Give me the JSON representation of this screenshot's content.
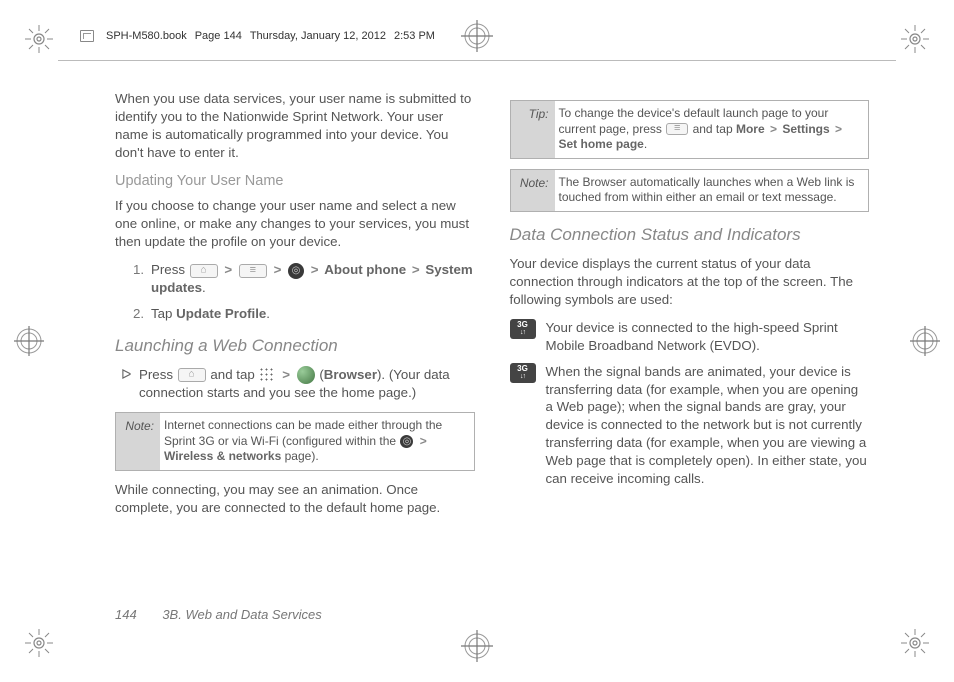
{
  "header": {
    "filename": "SPH-M580.book",
    "page_ref": "Page 144",
    "date": "Thursday, January 12, 2012",
    "time": "2:53 PM"
  },
  "left": {
    "intro": "When you use data services, your user name is submitted to identify you to the Nationwide Sprint Network. Your user name is automatically programmed into your device. You don't have to enter it.",
    "h_update": "Updating Your User Name",
    "update_text": "If you choose to change your user name and select a new one online, or make any changes to your services, you must then update the profile on your device.",
    "step1_a": "Press",
    "step1_about": "About phone",
    "step1_sys": "System updates",
    "step2_a": "Tap",
    "step2_b": "Update Profile",
    "h_launch": "Launching a Web Connection",
    "launch_a": "Press",
    "launch_b": "and tap",
    "launch_browser": "Browser",
    "launch_c": "(Your data connection starts and you see the home page.)",
    "note1_label": "Note:",
    "note1_text_a": "Internet connections can be made either through the Sprint 3G or via Wi-Fi (configured within the",
    "note1_wireless": "Wireless & networks",
    "note1_text_b": "page).",
    "connect_text": "While connecting, you may see an animation. Once complete, you are connected to the default home page."
  },
  "right": {
    "tip_label": "Tip:",
    "tip_text_a": "To change the device's default launch page to your current page, press",
    "tip_text_b": "and tap",
    "tip_more": "More",
    "tip_settings": "Settings",
    "tip_set_home": "Set home page",
    "note2_label": "Note:",
    "note2_text": "The Browser automatically launches when a Web link is touched from within either an email or text message.",
    "h_status": "Data Connection Status and Indicators",
    "status_intro": "Your device displays the current status of your data connection through indicators at the top of the screen. The following symbols are used:",
    "ind1": "Your device is connected to the high-speed Sprint Mobile Broadband Network (EVDO).",
    "ind2": "When the signal bands are animated, your device is transferring data (for example, when you are opening a Web page); when the signal bands are gray, your device is connected to the network but is not currently transferring data (for example, when you are viewing a Web page that is completely open). In either state, you can receive incoming calls."
  },
  "footer": {
    "page": "144",
    "section": "3B. Web and Data Services"
  }
}
